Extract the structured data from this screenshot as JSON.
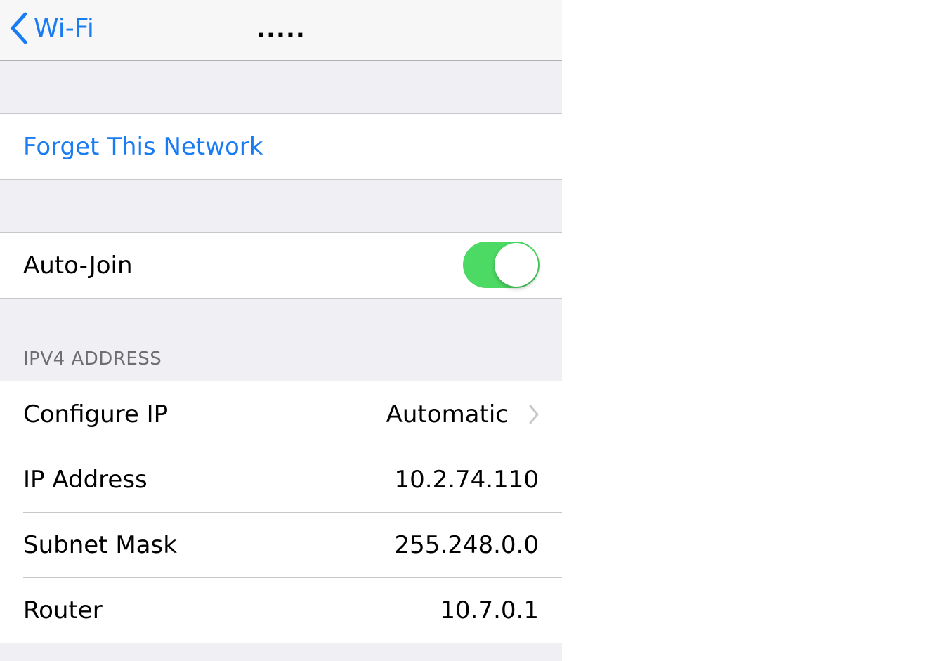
{
  "navbar": {
    "back_label": "Wi-Fi",
    "title": "....."
  },
  "forget_group": {
    "forget_label": "Forget This Network"
  },
  "autojoin_group": {
    "label": "Auto-Join",
    "enabled": true
  },
  "ipv4": {
    "header": "IPV4 ADDRESS",
    "rows": [
      {
        "label": "Configure IP",
        "value": "Automatic"
      },
      {
        "label": "IP Address",
        "value": "10.2.74.110"
      },
      {
        "label": "Subnet Mask",
        "value": "255.248.0.0"
      },
      {
        "label": "Router",
        "value": "10.7.0.1"
      }
    ]
  },
  "colors": {
    "accent": "#1a7cf3",
    "toggle_on": "#4cd964",
    "group_bg": "#efeff4"
  }
}
